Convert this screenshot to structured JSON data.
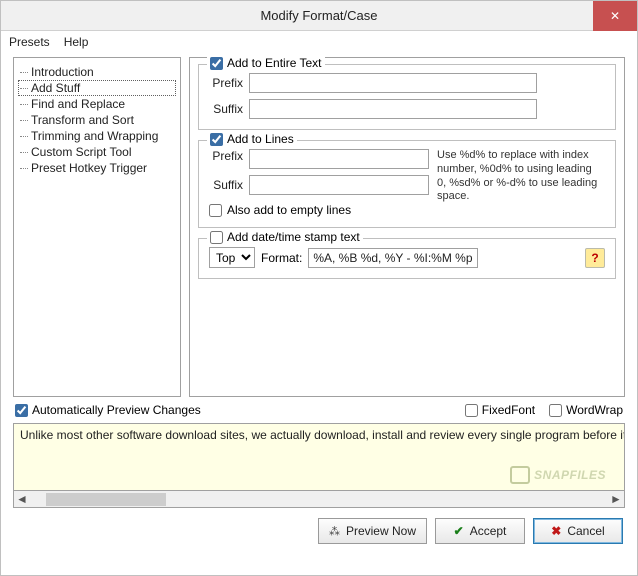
{
  "window": {
    "title": "Modify Format/Case"
  },
  "menu": {
    "presets": "Presets",
    "help": "Help"
  },
  "tree": {
    "items": [
      "Introduction",
      "Add Stuff",
      "Find and Replace",
      "Transform and Sort",
      "Trimming and Wrapping",
      "Custom Script Tool",
      "Preset Hotkey Trigger"
    ],
    "selected_index": 1
  },
  "group_entire": {
    "title": "Add to Entire Text",
    "checked": true,
    "prefix_label": "Prefix",
    "prefix_value": "",
    "suffix_label": "Suffix",
    "suffix_value": ""
  },
  "group_lines": {
    "title": "Add to Lines",
    "checked": true,
    "prefix_label": "Prefix",
    "prefix_value": "",
    "suffix_label": "Suffix",
    "suffix_value": "",
    "hint": "Use %d% to replace with index number, %0d% to using leading 0, %sd% or %-d% to use leading space.",
    "empty_label": "Also add to empty lines",
    "empty_checked": false
  },
  "group_date": {
    "title": "Add date/time stamp text",
    "checked": false,
    "position_label": "Top",
    "format_label": "Format:",
    "format_value": "%A, %B %d, %Y - %I:%M %p"
  },
  "options": {
    "auto_preview": "Automatically Preview Changes",
    "auto_preview_checked": true,
    "fixed_font": "FixedFont",
    "fixed_font_checked": false,
    "word_wrap": "WordWrap",
    "word_wrap_checked": false
  },
  "preview_text": "Unlike most other software download sites, we actually download, install and review every single program before it is listed on the sit",
  "watermark": "SNAPFILES",
  "buttons": {
    "preview": "Preview Now",
    "accept": "Accept",
    "cancel": "Cancel"
  }
}
